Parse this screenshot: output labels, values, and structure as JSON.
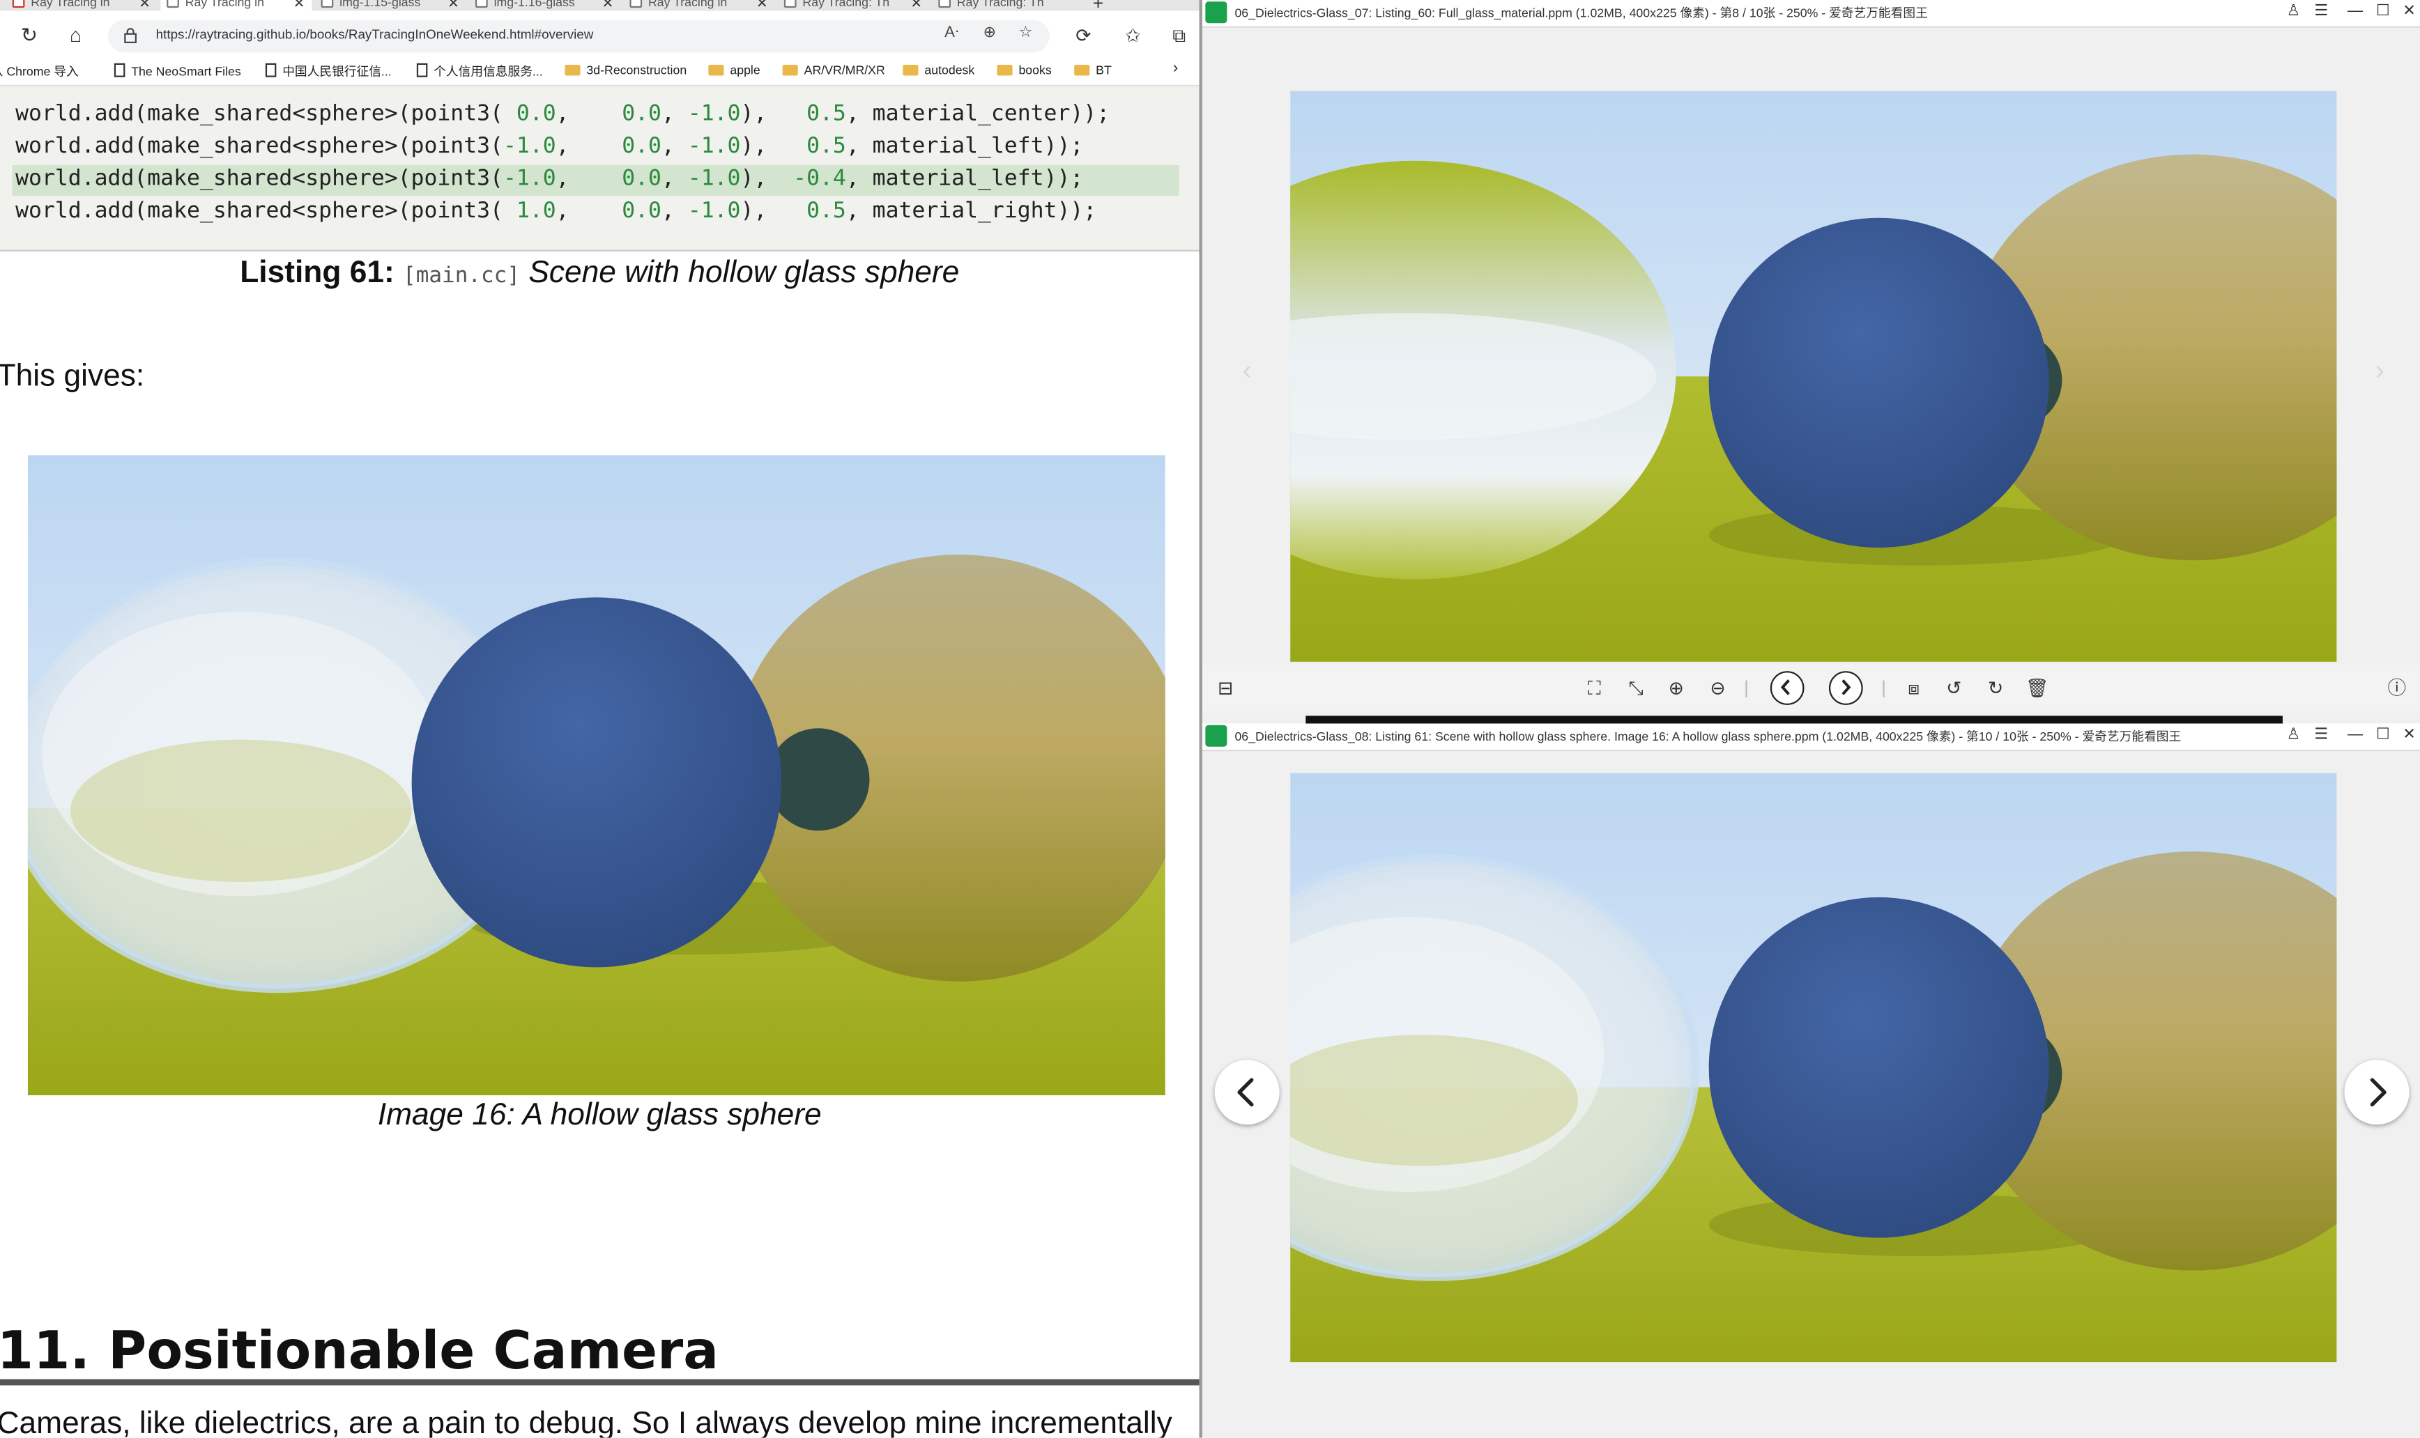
{
  "browser": {
    "tabs": [
      {
        "title": "Ray Tracing in",
        "active": false
      },
      {
        "title": "Ray Tracing in",
        "active": true
      },
      {
        "title": "img-1.15-glass",
        "active": false
      },
      {
        "title": "img-1.16-glass",
        "active": false
      },
      {
        "title": "Ray Tracing in",
        "active": false
      },
      {
        "title": "Ray Tracing: Th",
        "active": false
      },
      {
        "title": "Ray Tracing: Th",
        "active": false
      }
    ],
    "new_tab_label": "+",
    "url": "https://raytracing.github.io/books/RayTracingInOneWeekend.html#overview",
    "bookmarks": [
      {
        "label": "从 Chrome 导入",
        "type": "none"
      },
      {
        "label": "The NeoSmart Files",
        "type": "page"
      },
      {
        "label": "中国人民银行征信...",
        "type": "page"
      },
      {
        "label": "个人信用信息服务...",
        "type": "page"
      },
      {
        "label": "3d-Reconstruction",
        "type": "folder"
      },
      {
        "label": "apple",
        "type": "folder"
      },
      {
        "label": "AR/VR/MR/XR",
        "type": "folder"
      },
      {
        "label": "autodesk",
        "type": "folder"
      },
      {
        "label": "books",
        "type": "folder"
      },
      {
        "label": "BT",
        "type": "folder"
      }
    ],
    "bookmarks_overflow": "›"
  },
  "doc": {
    "code_lines": [
      {
        "prefix": "world.add(make_shared<sphere>(point3(",
        "x": " 0.0",
        "y": "0.0",
        "z": "-1.0",
        "r": "0.5",
        "mat": "material_center"
      },
      {
        "prefix": "world.add(make_shared<sphere>(point3(",
        "x": "-1.0",
        "y": "0.0",
        "z": "-1.0",
        "r": "0.5",
        "mat": "material_left"
      },
      {
        "prefix": "world.add(make_shared<sphere>(point3(",
        "x": "-1.0",
        "y": "0.0",
        "z": "-1.0",
        "r": "-0.4",
        "mat": "material_left"
      },
      {
        "prefix": "world.add(make_shared<sphere>(point3(",
        "x": " 1.0",
        "y": "0.0",
        "z": "-1.0",
        "r": "0.5",
        "mat": "material_right"
      }
    ],
    "listing_label": "Listing 61:",
    "listing_file": "[main.cc]",
    "listing_caption": "Scene with hollow glass sphere",
    "gives": "This gives:",
    "image_caption": "Image 16: A hollow glass sphere",
    "section_heading": "11.  Positionable Camera",
    "continuation": "Cameras, like dielectrics, are a pain to debug. So I always develop mine incrementally"
  },
  "viewer_top": {
    "title": "06_Dielectrics-Glass_07: Listing_60: Full_glass_material.ppm (1.02MB, 400x225 像素) - 第8 / 10张 - 250% - 爱奇艺万能看图王"
  },
  "viewer_bottom": {
    "title": "06_Dielectrics-Glass_08: Listing 61: Scene with hollow glass sphere.  Image 16: A hollow glass sphere.ppm (1.02MB, 400x225 像素) - 第10 / 10张 - 250% - 爱奇艺万能看图王"
  },
  "colors": {
    "code_number": "#2a8a3e",
    "code_highlight": "#d3e4cf",
    "sky_top": "#bcd6f2",
    "ground": "#a6b21c",
    "blue_sphere": "#3d5c98",
    "gold_sphere": "#a69a52",
    "app_green": "#1ba04c"
  }
}
